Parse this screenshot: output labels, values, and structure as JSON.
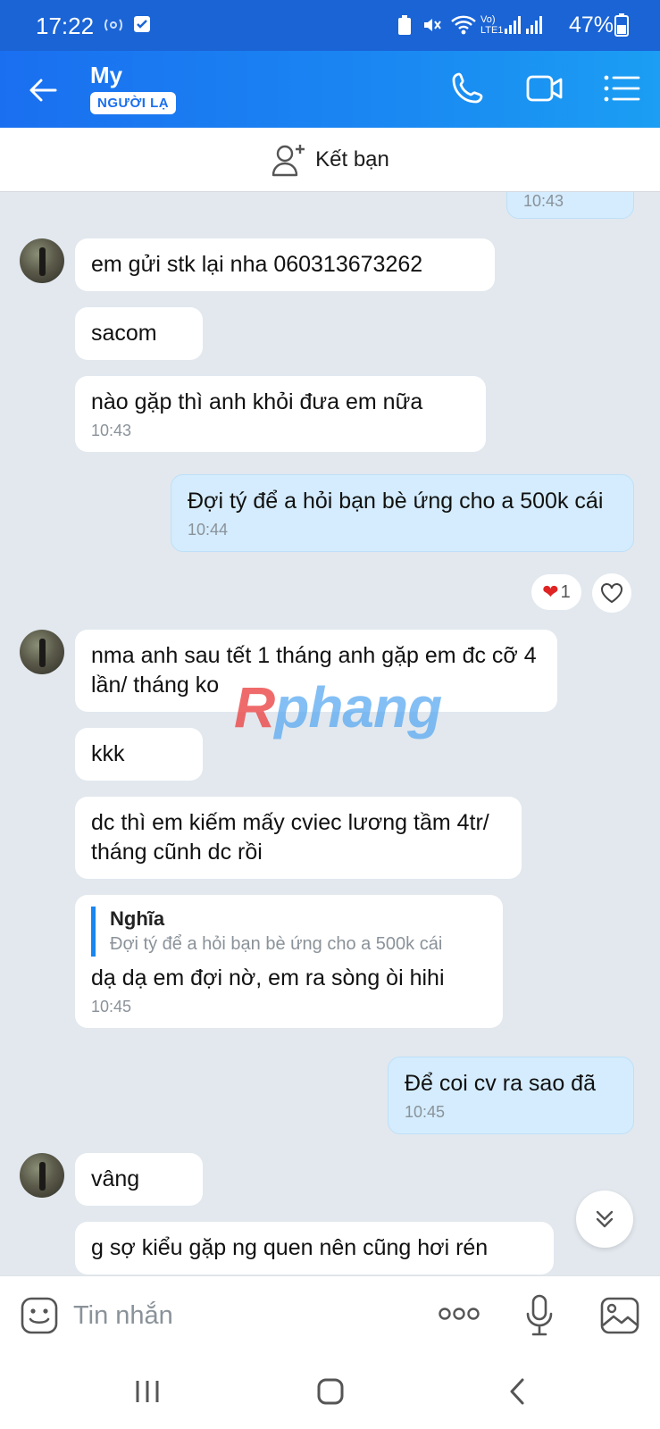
{
  "status_bar": {
    "time": "17:22",
    "battery": "47%",
    "network": "Vo) LTE1"
  },
  "header": {
    "contact_name": "My",
    "badge": "NGƯỜI LẠ"
  },
  "add_friend": {
    "label": "Kết bạn"
  },
  "messages": [
    {
      "id": "m0",
      "dir": "out",
      "text": "",
      "time": "10:43"
    },
    {
      "id": "m1",
      "dir": "in",
      "text": "em gửi stk lại nha 060313673262",
      "time": ""
    },
    {
      "id": "m2",
      "dir": "in",
      "text": "sacom",
      "time": ""
    },
    {
      "id": "m3",
      "dir": "in",
      "text": "nào gặp thì anh khỏi đưa em nữa",
      "time": "10:43"
    },
    {
      "id": "m4",
      "dir": "out",
      "text": "Đợi tý để a hỏi bạn bè ứng cho a 500k cái",
      "time": "10:44",
      "reaction_count": "1"
    },
    {
      "id": "m5",
      "dir": "in",
      "text": "nma anh sau tết 1 tháng anh gặp em đc cỡ 4 lần/ tháng ko",
      "time": ""
    },
    {
      "id": "m6",
      "dir": "in",
      "text": "kkk",
      "time": ""
    },
    {
      "id": "m7",
      "dir": "in",
      "text": "dc thì em kiếm mấy cviec lương tầm 4tr/ tháng cũnh dc rồi",
      "time": ""
    },
    {
      "id": "m8",
      "dir": "in",
      "quote_author": "Nghĩa",
      "quote_text": "Đợi tý để a hỏi bạn bè ứng cho a 500k cái",
      "text": "dạ dạ em đợi nờ, em ra sòng òi hihi",
      "time": "10:45"
    },
    {
      "id": "m9",
      "dir": "out",
      "text": "Để coi cv ra sao đã",
      "time": "10:45"
    },
    {
      "id": "m10",
      "dir": "in",
      "text": "vâng",
      "time": ""
    },
    {
      "id": "m11",
      "dir": "in",
      "text": "g sợ kiểu gặp ng quen nên cũng hơi rén",
      "time": ""
    }
  ],
  "watermark": {
    "first": "R",
    "rest": "phang"
  },
  "input": {
    "placeholder": "Tin nhắn"
  },
  "colors": {
    "header": "#1a6ff0",
    "bubble_out": "#d4ecfd",
    "bubble_in": "#ffffff",
    "background": "#e2e8ee"
  }
}
